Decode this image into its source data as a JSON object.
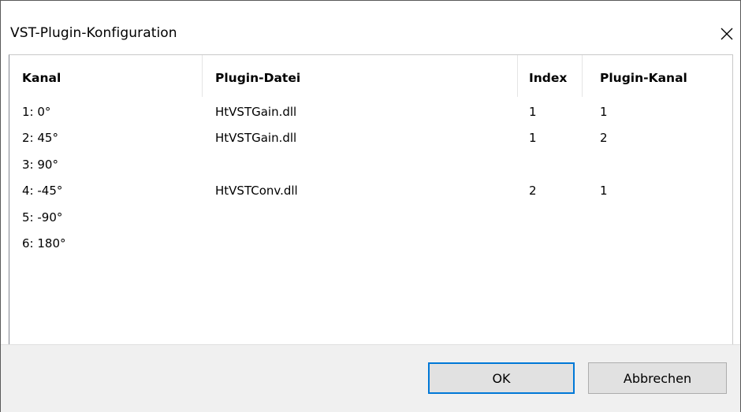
{
  "window": {
    "title": "VST-Plugin-Konfiguration",
    "close_glyph": "✕"
  },
  "columns": {
    "kanal": "Kanal",
    "plugin_datei": "Plugin-Datei",
    "index": "Index",
    "plugin_kanal": "Plugin-Kanal"
  },
  "rows": [
    {
      "kanal": "1: 0°",
      "plugin_datei": "HtVSTGain.dll",
      "index": "1",
      "plugin_kanal": "1"
    },
    {
      "kanal": "2: 45°",
      "plugin_datei": "HtVSTGain.dll",
      "index": "1",
      "plugin_kanal": "2"
    },
    {
      "kanal": "3: 90°",
      "plugin_datei": "",
      "index": "",
      "plugin_kanal": ""
    },
    {
      "kanal": "4: -45°",
      "plugin_datei": "HtVSTConv.dll",
      "index": "2",
      "plugin_kanal": "1"
    },
    {
      "kanal": "5: -90°",
      "plugin_datei": "",
      "index": "",
      "plugin_kanal": ""
    },
    {
      "kanal": "6: 180°",
      "plugin_datei": "",
      "index": "",
      "plugin_kanal": ""
    }
  ],
  "buttons": {
    "ok": "OK",
    "cancel": "Abbrechen"
  },
  "icons": {
    "close": "close-icon"
  },
  "colors": {
    "accent": "#0078d7",
    "footer_bg": "#f0f0f0",
    "button_bg": "#e1e1e1"
  }
}
